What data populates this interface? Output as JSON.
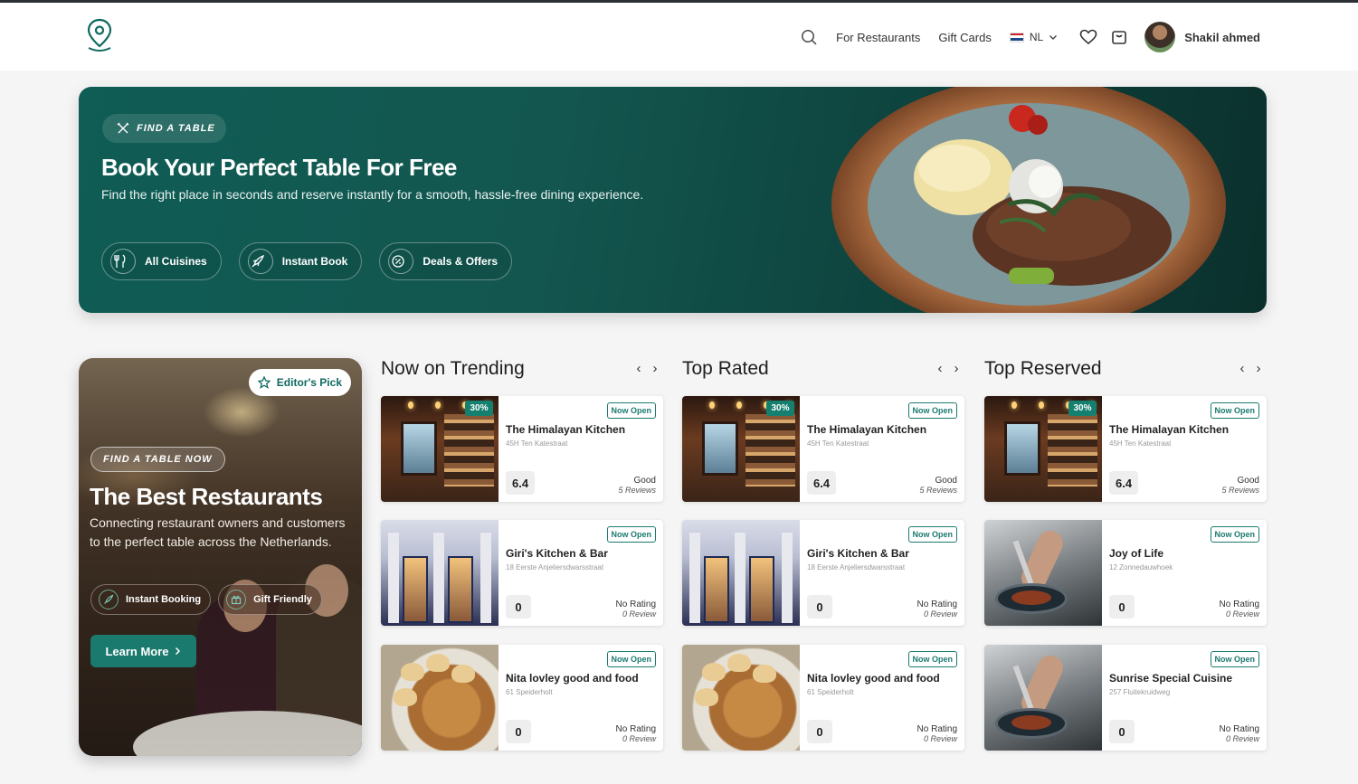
{
  "header": {
    "for_restaurants": "For Restaurants",
    "gift_cards": "Gift Cards",
    "language": "NL",
    "user_name": "Shakil ahmed",
    "icons": [
      "location-pin-logo",
      "search-icon",
      "chevron-down-icon",
      "heart-icon",
      "cart-icon"
    ]
  },
  "hero": {
    "pill": "FIND A TABLE",
    "title": "Book Your Perfect Table For Free",
    "subtitle": "Find the right place in seconds and reserve instantly for a smooth, hassle-free dining experience.",
    "chips": [
      {
        "label": "All Cuisines",
        "icon": "fork-knife-icon"
      },
      {
        "label": "Instant Book",
        "icon": "rocket-icon"
      },
      {
        "label": "Deals & Offers",
        "icon": "discount-icon"
      }
    ]
  },
  "promo": {
    "editors_pick": "Editor's Pick",
    "pill": "FIND A TABLE NOW",
    "title": "The Best Restaurants",
    "text": "Connecting restaurant owners and customers to the perfect table across the Netherlands.",
    "chips": [
      {
        "label": "Instant Booking",
        "icon": "rocket-icon"
      },
      {
        "label": "Gift Friendly",
        "icon": "gift-icon"
      }
    ],
    "learn_more": "Learn More"
  },
  "columns": [
    {
      "title": "Now on Trending",
      "cards": [
        {
          "name": "The Himalayan Kitchen",
          "address": "45H Ten Katestraat",
          "badge": "30%",
          "status": "Now Open",
          "score": "6.4",
          "rating": "Good",
          "reviews": "5 Reviews",
          "image": "bar"
        },
        {
          "name": "Giri's Kitchen & Bar",
          "address": "18 Eerste Anjeliersdwarsstraat",
          "badge": "",
          "status": "Now Open",
          "score": "0",
          "rating": "No Rating",
          "reviews": "0 Review",
          "image": "facade"
        },
        {
          "name": "Nita lovley good and food",
          "address": "61 Speiderholt",
          "badge": "",
          "status": "Now Open",
          "score": "0",
          "rating": "No Rating",
          "reviews": "0 Review",
          "image": "food"
        }
      ]
    },
    {
      "title": "Top Rated",
      "cards": [
        {
          "name": "The Himalayan Kitchen",
          "address": "45H Ten Katestraat",
          "badge": "30%",
          "status": "Now Open",
          "score": "6.4",
          "rating": "Good",
          "reviews": "5 Reviews",
          "image": "bar"
        },
        {
          "name": "Giri's Kitchen & Bar",
          "address": "18 Eerste Anjeliersdwarsstraat",
          "badge": "",
          "status": "Now Open",
          "score": "0",
          "rating": "No Rating",
          "reviews": "0 Review",
          "image": "facade"
        },
        {
          "name": "Nita lovley good and food",
          "address": "61 Speiderholt",
          "badge": "",
          "status": "Now Open",
          "score": "0",
          "rating": "No Rating",
          "reviews": "0 Review",
          "image": "food"
        }
      ]
    },
    {
      "title": "Top Reserved",
      "cards": [
        {
          "name": "The Himalayan Kitchen",
          "address": "45H Ten Katestraat",
          "badge": "30%",
          "status": "Now Open",
          "score": "6.4",
          "rating": "Good",
          "reviews": "5 Reviews",
          "image": "bar"
        },
        {
          "name": "Joy of Life",
          "address": "12 Zonnedauwhoek",
          "badge": "",
          "status": "Now Open",
          "score": "0",
          "rating": "No Rating",
          "reviews": "0 Review",
          "image": "chef"
        },
        {
          "name": "Sunrise Special Cuisine",
          "address": "257 Fluitekruidweg",
          "badge": "",
          "status": "Now Open",
          "score": "0",
          "rating": "No Rating",
          "reviews": "0 Review",
          "image": "chef"
        }
      ]
    }
  ],
  "colors": {
    "brand": "#1b7a6e",
    "hero_bg": "#0f5d55",
    "badge": "#15806f"
  }
}
